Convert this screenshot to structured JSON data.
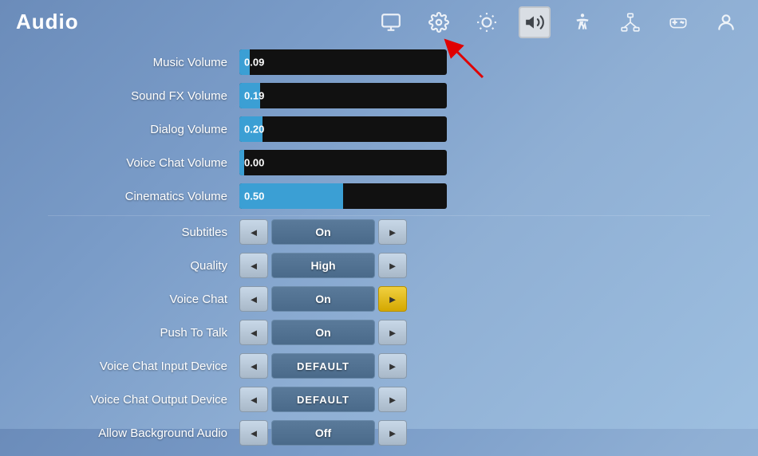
{
  "header": {
    "title": "Audio",
    "nav_icons": [
      {
        "name": "monitor-icon",
        "symbol": "🖥",
        "active": false,
        "label": "Display"
      },
      {
        "name": "gear-icon",
        "symbol": "⚙",
        "active": false,
        "label": "Settings"
      },
      {
        "name": "brightness-icon",
        "symbol": "☀",
        "active": false,
        "label": "Brightness"
      },
      {
        "name": "audio-icon",
        "symbol": "🔊",
        "active": true,
        "label": "Audio"
      },
      {
        "name": "accessibility-icon",
        "symbol": "♿",
        "active": false,
        "label": "Accessibility"
      },
      {
        "name": "network-icon",
        "symbol": "⬡",
        "active": false,
        "label": "Network"
      },
      {
        "name": "controller-icon",
        "symbol": "🎮",
        "active": false,
        "label": "Controller"
      },
      {
        "name": "account-icon",
        "symbol": "👤",
        "active": false,
        "label": "Account"
      }
    ]
  },
  "settings": {
    "sliders": [
      {
        "label": "Music Volume",
        "value": "0.09",
        "fill_pct": 5
      },
      {
        "label": "Sound FX Volume",
        "value": "0.19",
        "fill_pct": 10
      },
      {
        "label": "Dialog Volume",
        "value": "0.20",
        "fill_pct": 11
      },
      {
        "label": "Voice Chat Volume",
        "value": "0.00",
        "fill_pct": 0
      },
      {
        "label": "Cinematics Volume",
        "value": "0.50",
        "fill_pct": 50
      }
    ],
    "toggles": [
      {
        "label": "Subtitles",
        "value": "On",
        "right_highlighted": false
      },
      {
        "label": "Quality",
        "value": "High",
        "right_highlighted": false
      },
      {
        "label": "Voice Chat",
        "value": "On",
        "right_highlighted": true
      },
      {
        "label": "Push To Talk",
        "value": "On",
        "right_highlighted": false
      },
      {
        "label": "Voice Chat Input Device",
        "value": "DEFAULT",
        "right_highlighted": false
      },
      {
        "label": "Voice Chat Output Device",
        "value": "DEFAULT",
        "right_highlighted": false
      },
      {
        "label": "Allow Background Audio",
        "value": "Off",
        "right_highlighted": false
      }
    ]
  },
  "arrow": {
    "left": "◄",
    "right": "►"
  }
}
